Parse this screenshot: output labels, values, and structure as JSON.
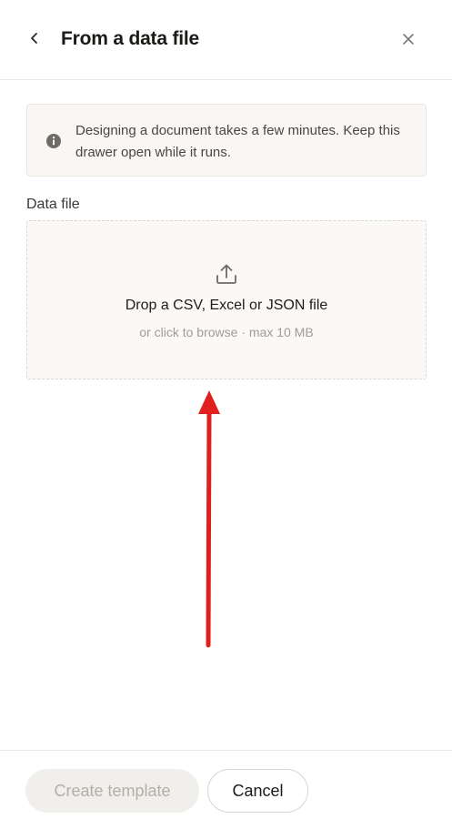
{
  "header": {
    "title": "From a data file",
    "back_icon": "chevron-left-icon",
    "close_icon": "close-icon"
  },
  "notice": {
    "icon": "info-icon",
    "text": "Designing a document takes a few minutes. Keep this drawer open while it runs."
  },
  "data_file": {
    "label": "Data file",
    "dropzone": {
      "icon": "upload-icon",
      "title": "Drop a CSV, Excel or JSON file",
      "subtitle": "or click to browse · max 10 MB"
    }
  },
  "annotation": {
    "arrow_color": "#e0201f"
  },
  "footer": {
    "create_label": "Create template",
    "cancel_label": "Cancel"
  }
}
